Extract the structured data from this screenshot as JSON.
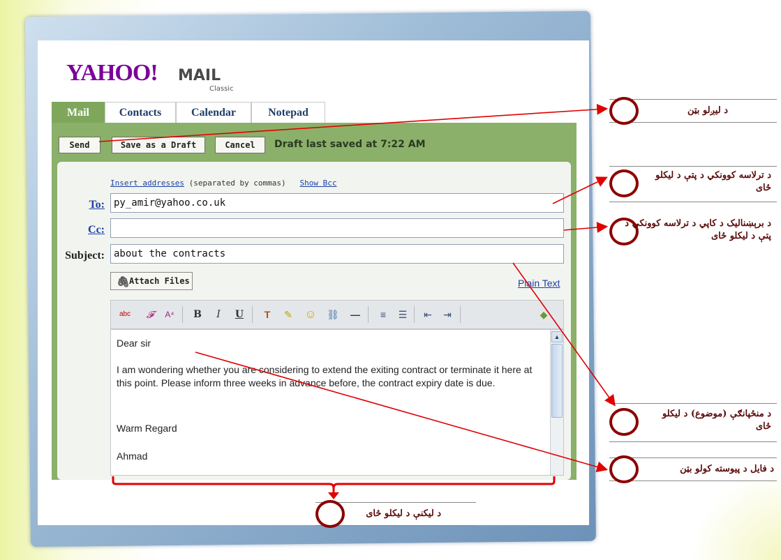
{
  "logo": {
    "yahoo": "YAHOO!",
    "mail": "MAIL",
    "classic": "Classic"
  },
  "tabs": [
    {
      "label": "Mail",
      "active": true
    },
    {
      "label": "Contacts",
      "active": false
    },
    {
      "label": "Calendar",
      "active": false
    },
    {
      "label": "Notepad",
      "active": false
    }
  ],
  "toolbar": {
    "send_label": "Send",
    "save_draft_label": "Save as a Draft",
    "cancel_label": "Cancel",
    "draft_status": "Draft last saved at 7:22 AM"
  },
  "compose": {
    "insert_addresses": "Insert addresses",
    "separated_note": "(separated by commas)",
    "show_bcc": "Show Bcc",
    "to_label": "To:",
    "to_value": "py_amir@yahoo.co.uk",
    "cc_label": "Cc:",
    "cc_value": "",
    "subject_label": "Subject:",
    "subject_value": "about the contracts",
    "attach_label": "Attach Files",
    "plain_text_label": "Plain Text"
  },
  "editor_toolbar": [
    "spellcheck-icon",
    "font-family-icon",
    "font-size-icon",
    "bold-icon",
    "italic-icon",
    "underline-icon",
    "text-color-icon",
    "highlight-icon",
    "emoticon-icon",
    "link-icon",
    "horizontal-rule-icon",
    "align-icon",
    "bullet-list-icon",
    "outdent-icon",
    "indent-icon",
    "stationery-icon"
  ],
  "editor_toolbar_glyphs": [
    "abc",
    "𝓕",
    "A⁴",
    "B",
    "I",
    "U",
    "T",
    "✎",
    "☺",
    "⛓",
    "—",
    "≡",
    "☰",
    "⇤",
    "⇥",
    "◆"
  ],
  "body": {
    "line1": "Dear sir",
    "line2": "I am wondering whether you are considering to extend the exiting contract or terminate it here at this point. Please inform three weeks in advance before, the contract expiry date is due.",
    "line3": "Warm Regard",
    "line4": "Ahmad"
  },
  "callouts": {
    "send": "د لیږلو بټن",
    "to": "د ترلاسه کوونکي د پتې د لیکلو ځای",
    "cc": "د برېښنالیک د کاپي د ترلاسه کوونکي  د پتې د لیکلو ځای",
    "subject": "د منځپانګې (موضوع)  د لیکلو ځای",
    "attach": "د فایل د پیوسته کولو بټن",
    "body": "د لیکنې د لیکلو ځای"
  },
  "colors": {
    "accent_green": "#8bb06a",
    "annotation_red": "#e00000",
    "yahoo_purple": "#7b0099"
  }
}
